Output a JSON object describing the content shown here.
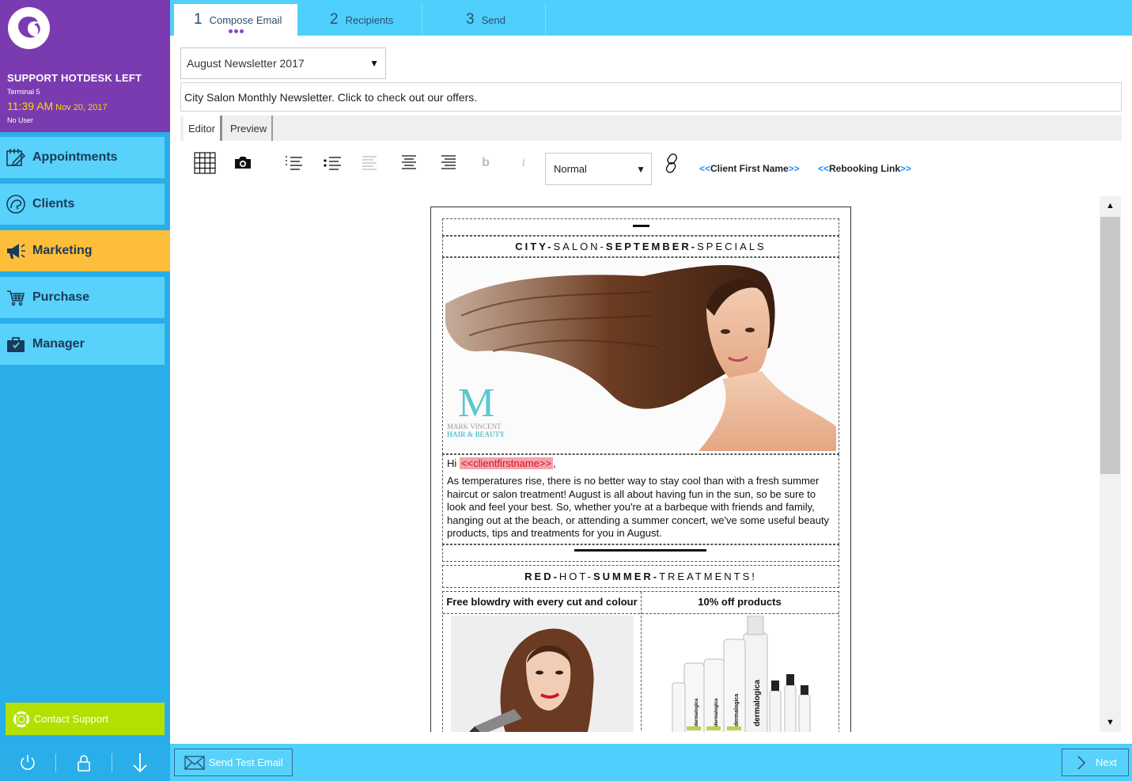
{
  "sidebar": {
    "location": "SUPPORT HOTDESK LEFT",
    "terminal": "Terminal 5",
    "time": "11:39 AM",
    "date": "Nov 20, 2017",
    "user": "No User",
    "nav": [
      {
        "label": "Appointments",
        "icon": "calendar-edit-icon"
      },
      {
        "label": "Clients",
        "icon": "client-head-icon"
      },
      {
        "label": "Marketing",
        "icon": "megaphone-icon",
        "active": true
      },
      {
        "label": "Purchase",
        "icon": "cart-icon"
      },
      {
        "label": "Manager",
        "icon": "briefcase-icon"
      }
    ],
    "contact_support": "Contact Support",
    "bottom_icons": [
      "power-icon",
      "lock-icon",
      "download-arrow-icon"
    ]
  },
  "steps": [
    {
      "num": "1",
      "label": "Compose Email",
      "active": true
    },
    {
      "num": "2",
      "label": "Recipients"
    },
    {
      "num": "3",
      "label": "Send"
    }
  ],
  "compose": {
    "template": "August Newsletter 2017",
    "subject": "City Salon Monthly Newsletter. Click to check out our offers.",
    "tabs": [
      "Editor",
      "Preview"
    ],
    "format": "Normal",
    "merge_client_first_name": "Client First Name",
    "merge_rebooking_link": "Rebooking Link",
    "merge_open": "<<",
    "merge_close": ">>"
  },
  "newsletter": {
    "heading1_parts": [
      "CITY-",
      "SALON-",
      "SEPTEMBER-",
      "SPECIALS"
    ],
    "brand_mark": "M",
    "brand_line1": "MARK VINCENT",
    "brand_line2": "HAIR & BEAUTY",
    "greeting": "Hi",
    "greeting_tag": "<<clientfirstname>>",
    "greeting_comma": ",",
    "body": "As temperatures rise, there is no better way to stay cool than with a fresh summer haircut or salon treatment!  August is all about having fun in the sun, so be sure to look and feel your best.  So, whether you're at a barbeque with friends and family, hanging out at the beach, or attending a summer concert, we've some useful beauty products, tips and treatments for you in August.",
    "heading2_parts": [
      "RED-",
      "HOT-",
      "SUMMER-",
      "TREATMENTS!"
    ],
    "col1_title": "Free blowdry with every cut and colour",
    "col2_title": "10% off products",
    "product_brand": "dermalogica"
  },
  "footer": {
    "send_test": "Send Test Email",
    "next": "Next"
  },
  "colors": {
    "sidebar_header": "#7b3bb0",
    "sidebar_bg": "#2aaee9",
    "nav_item": "#58d1fb",
    "nav_active": "#fdbe3b",
    "topbar": "#4fd0fc",
    "contact_support": "#b3e000",
    "time": "#ffd600"
  }
}
